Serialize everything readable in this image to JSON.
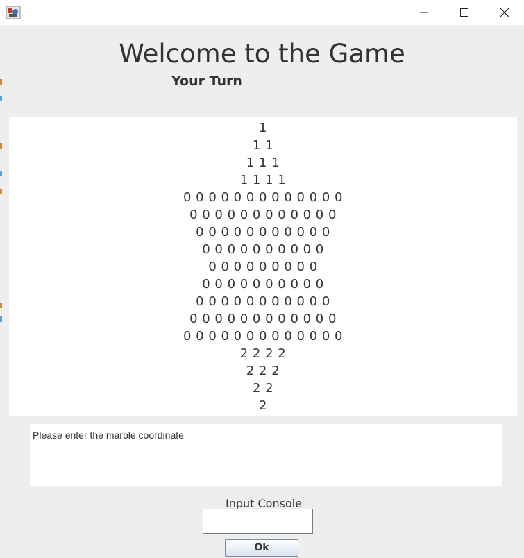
{
  "window": {
    "icons": {
      "app": "java-app-icon",
      "minimize": "minimize-icon",
      "maximize": "maximize-icon",
      "close": "close-icon"
    }
  },
  "header": {
    "title": "Welcome to the Game",
    "turn": "Your Turn"
  },
  "board": {
    "rows": [
      "1",
      "1 1",
      "1 1 1",
      "1 1 1 1",
      "0 0 0 0 0 0 0 0 0 0 0 0 0",
      "0 0 0 0 0 0 0 0 0 0 0 0",
      "0 0 0 0 0 0 0 0 0 0 0",
      "0 0 0 0 0 0 0 0 0 0",
      "0 0 0 0 0 0 0 0 0",
      "0 0 0 0 0 0 0 0 0 0",
      "0 0 0 0 0 0 0 0 0 0 0",
      "0 0 0 0 0 0 0 0 0 0 0 0",
      "0 0 0 0 0 0 0 0 0 0 0 0 0",
      "2 2 2 2",
      "2 2 2",
      "2 2",
      "2"
    ]
  },
  "message": {
    "text": "Please enter the marble coordinate"
  },
  "console": {
    "label": "Input Console",
    "value": "",
    "ok_label": "Ok"
  },
  "colors": {
    "background": "#eeeeee",
    "panel": "#ffffff",
    "text": "#333333"
  }
}
